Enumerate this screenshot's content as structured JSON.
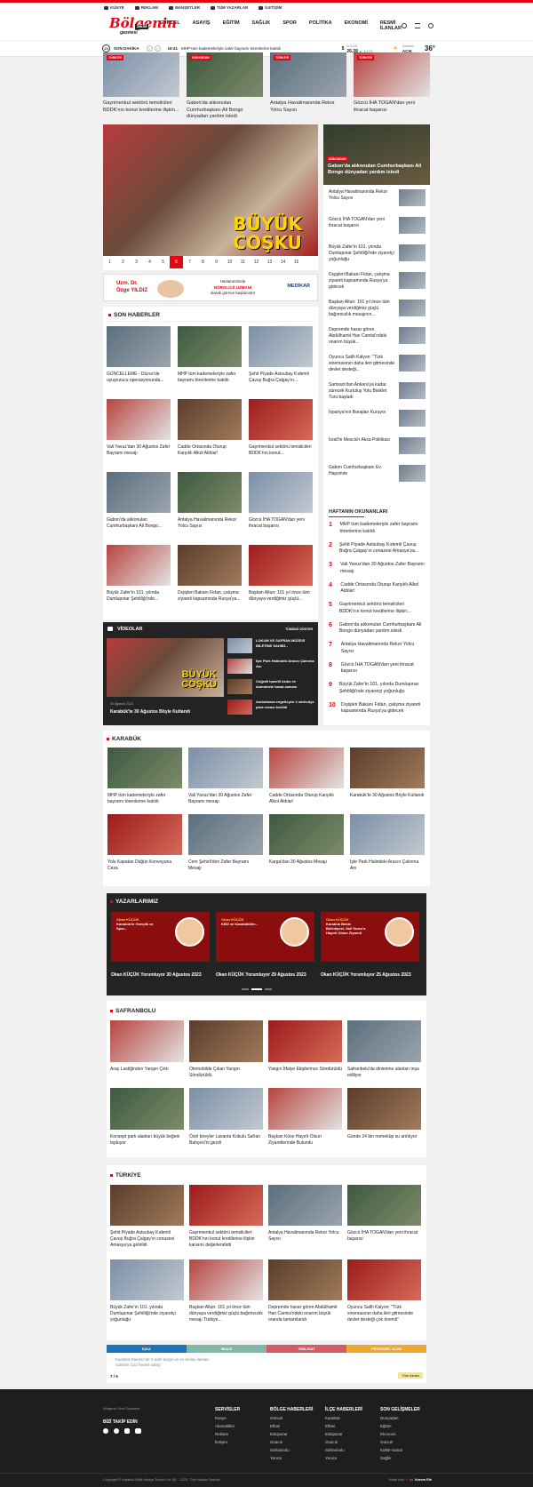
{
  "toplinks": [
    "KÜNYE",
    "REKLAM",
    "MANŞETLER",
    "TÜM YAZARLAR",
    "İLETİŞİM"
  ],
  "logo": {
    "main": "Bölgenin",
    "sub": "gazetesi",
    "badge": "SESİ"
  },
  "nav": [
    "GÜNCEL",
    "ASAYİŞ",
    "EĞİTİM",
    "SAĞLIK",
    "SPOR",
    "POLİTİKA",
    "EKONOMİ",
    "RESMİ İLANLAR"
  ],
  "ticker": {
    "label": "SON DAKİKA",
    "time": "16:41",
    "text": "MHP tüm kademeleriyle zafer bayramı törenlerine katıldı",
    "fx_label": "DOLAR",
    "fx_value": "26,38",
    "fx_change": "▲ -0,17%",
    "wx_city": "Karabük",
    "wx_state": "AÇIK",
    "wx_temp": "36°"
  },
  "top_cards": [
    {
      "tag": "TÜRKİYE",
      "title": "Gayrimenkul sektörü temsilcileri BDDK'nın konut kredilerine ilişkin..."
    },
    {
      "tag": "DÜNYADAN",
      "title": "Gabon'da alıkonulan Cumhurbaşkanı Ali Bongo dünyadan yardım istedi"
    },
    {
      "tag": "TÜRKİYE",
      "title": "Antalya Havalimanında Rekor Yolcu Sayısı"
    },
    {
      "tag": "TÜRKİYE",
      "title": "Gözcü İHA TOGAN'dan yeni ihracat başarısı"
    }
  ],
  "hero": {
    "caption1": "BÜYÜK",
    "caption2": "COŞKU"
  },
  "pages": [
    "1",
    "2",
    "3",
    "4",
    "5",
    "6",
    "7",
    "8",
    "9",
    "10",
    "11",
    "12",
    "13",
    "14",
    "15"
  ],
  "ad": {
    "left1": "Uzm. Dr.",
    "left2": "Özge YILDIZ",
    "mid1": "Hastanemizde",
    "mid2": "NÖROLOJİ UZMANI",
    "mid3": "olarak göreve başlamıştır",
    "right": "MEDİKAR"
  },
  "side_feature": {
    "tag": "DÜNYADAN",
    "title": "Gabon'da alıkonulan Cumhurbaşkanı Ali Bongo dünyadan yardım istedi"
  },
  "side_list": [
    "Antalya Havalimanında Rekor Yolcu Sayısı",
    "Gözcü İHA TOGAN'dan yeni ihracat başarısı",
    "Büyük Zafer'in 101. yılında Dumlupınar Şehitliği'nde ziyaretçi yoğunluğu",
    "Dışişleri Bakanı Fidan, çalışma ziyareti kapsamında Rusya'ya gidecek",
    "Başkan Altun: 101 yıl önce tüm dünyaya verdiğimiz güçlü bağımsızlık mesajının...",
    "Depremde hasar gören Abdülhamit Han Camisi'ndeki onarım büyük...",
    "Oyuncu Salih Kalyon: \"Türk sinemasının daha ileri gitmesinde devlet desteği...",
    "Samsun'dan Ankara'ya kadar sürecek Kurtuluş Yolu Bisiklet Turu başladı",
    "İspanya'nın Barajları Kuruyor",
    "İsrail'in Mescid-i Aksa Politikası",
    "Gabon Cumhurbaşkanı Ev Hapsinde"
  ],
  "son_haberler": {
    "title": "SON HABERLER",
    "items": [
      "GÜNCELLEME - Düzce'de uyuşturucu operasyonunda...",
      "MHP tüm kademeleriyle zafer bayramı törenlerine katıldı",
      "Şehit Piyade Astsubay Kıdemli Çavuş Buğra Çalgay'ın...",
      "Vali Yavuz'dan 30 Ağustos Zafer Bayramı mesajı",
      "Cadde Ortasında Oturup Karşıklı Alkol Aldılar!",
      "Gayrimenkul sektörü temsilcileri BDDK'nın konut...",
      "Gabon'da alıkonulan Cumhurbaşkanı Ali Bongo...",
      "Antalya Havalimanında Rekor Yolcu Sayısı",
      "Gözcü İHA TOGAN'dan yeni ihracat başarısı",
      "Büyük Zafer'in 101. yılında Dumlupınar Şehitliği'nde...",
      "Dışişleri Bakanı Fidan, çalışma ziyareti kapsamında Rusya'ya...",
      "Başkan Altun: 101 yıl önce tüm dünyaya verdiğimiz güçlü..."
    ]
  },
  "haftanin": {
    "title": "HAFTANIN OKUNANLARI",
    "items": [
      "MHP tüm kademeleriyle zafer bayramı törenlerine katıldı",
      "Şehit Piyade Astsubay Kıdemli Çavuş Buğra Çalgay'ın cenazesi Amasya'ya...",
      "Vali Yavuz'dan 30 Ağustos Zafer Bayramı mesajı",
      "Cadde Ortasında Oturup Karşıklı Alkol Aldılar!",
      "Gayrimenkul sektörü temsilcileri BDDK'nın konut kredilerine ilişkin...",
      "Gabon'da alıkonulan Cumhurbaşkanı Ali Bongo dünyadan yardım istedi",
      "Antalya Havalimanında Rekor Yolcu Sayısı",
      "Gözcü İHA TOGAN'dan yeni ihracat başarısı",
      "Büyük Zafer'in 101. yılında Dumlupınar Şehitliği'nde ziyaretçi yoğunluğu",
      "Dışişleri Bakanı Fidan, çalışma ziyareti kapsamında Rusya'ya gidecek"
    ]
  },
  "videolar": {
    "title": "VİDEOLAR",
    "all": "TÜMÜNÜ GÖSTER",
    "main_date": "30 Ağustos 2023",
    "main_title": "Karabük'te 30 Ağustos Böyle Kutlandı",
    "items": [
      "LOKUM VE SAFRAN MÜZESİ BİLETİNE SAHİBİ...",
      "İşte Park Halindeki Aracın Çalınma Anı",
      "Coğrafi işaretli üzüm ve domateste hasat zamanı",
      "Ambulansa engelleyen 2 sürücüye para cezası kesildi"
    ]
  },
  "karabuk": {
    "title": "KARABÜK",
    "items": [
      "MHP tüm kademeleriyle zafer bayramı törenlerine katıldı",
      "Vali Yavuz'dan 30 Ağustos Zafer Bayramı mesajı",
      "Cadde Ortasında Oturup Karşıklı Alkol Aldılar!",
      "Karabük'te 30 Ağustos Böyle Kutlandı",
      "Yolu Kapatan Düğün Konvoyuna Ceza",
      "Cem Şehirli'den Zafer Bayramı Mesajı",
      "Karga'dan 30 Ağustos Mesajı",
      "İşte Park Halindeki Aracın Çalınma Anı"
    ]
  },
  "yazarlar": {
    "title": "YAZARLARIMIZ",
    "items": [
      {
        "name": "Okan KÜÇÜK",
        "head": "Karabük'te Gençlik ve Spor...",
        "cap": "Okan KÜÇÜK Yorumluyor 30 Ağustos 2023"
      },
      {
        "name": "Okan KÜÇÜK",
        "head": "KBÜ ve Karabükliler...",
        "cap": "Okan KÜÇÜK Yorumluyor 29 Ağustos 2023"
      },
      {
        "name": "Okan KÜÇÜK",
        "head": "Karabük Belde Belediyesi, Vali Yavuz'a Hayırlı Olsun Ziyareti",
        "cap": "Okan KÜÇÜK Yorumluyor 25 Ağustos 2023"
      }
    ]
  },
  "safranbolu": {
    "title": "SAFRANBOLU",
    "items": [
      "Araç Lastiğinden Yangın Çıktı",
      "Otomobilde Çıkan Yangın Söndürüldü",
      "Yangın İtfaiye Ekiplerince Söndürüldü",
      "Safranbolu'da dinlenme alanları inşa ediliyor",
      "Konsept park alanları büyük beğeni topluyor",
      "Özel bireyler Lavanta Kokulu Safran Bahçesi'ni gezdi",
      "Başkan Köse Hayırlı Olsun Ziyaretlerinde Bulundu",
      "Günde 24 bin metreküp su arıtılıyor"
    ]
  },
  "turkiye": {
    "title": "TÜRKİYE",
    "items": [
      "Şehit Piyade Astsubay Kıdemli Çavuş Buğra Çalgay'ın cenazesi Amasya'ya getirildi",
      "Gayrimenkul sektörü temsilcileri BDDK'nın konut kredilerine ilişkin kararını değerlendirdi",
      "Antalya Havalimanında Rekor Yolcu Sayısı",
      "Gözcü İHA TOGAN'dan yeni ihracat başarısı",
      "Büyük Zafer'in 101. yılında Dumlupınar Şehitliği'nde ziyaretçi yoğunluğu",
      "Başkan Altun: 101 yıl önce tüm dünyaya verdiğimiz güçlü bağımsızlık mesajı Türkiye...",
      "Depremde hasar gören Abdülhamit Han Camisi'ndeki onarım büyük oranda tamamlandı",
      "Oyuncu Salih Kalyon: \"Türk sinemasının daha ileri gitmesinde devlet desteği çok önemli\""
    ]
  },
  "tabs": [
    "İÇKA",
    "İMALE",
    "TEBLİGAT",
    "PERSONEL ALIMI"
  ],
  "tabs_text": "Karabük Merkez'de 3 adet bargir ve ev arsası ilanları satılıktır (1/2 hisseli satış)",
  "tabs_counter": "7 / 9",
  "tabs_all": "Tüm ilanlar",
  "footer": {
    "site": "Bölgenin Sesi Gazetesi",
    "follow": "BİZİ TAKİP EDİN",
    "cols": [
      {
        "h": "SERVİSLER",
        "items": [
          "Künye",
          "Abonelikler",
          "Reklam",
          "İletişim"
        ]
      },
      {
        "h": "BÖLGE HABERLERİ",
        "items": [
          "Güncel",
          "Eflani",
          "Eskipazar",
          "Ovacık",
          "Safranbolu",
          "Yenice"
        ]
      },
      {
        "h": "İLÇE HABERLERİ",
        "items": [
          "Karabük",
          "Eflani",
          "Eskipazar",
          "Ovacık",
          "Safranbolu",
          "Yenice"
        ]
      },
      {
        "h": "SON GELİŞMELER",
        "items": [
          "Dünyadan",
          "Eğitim",
          "Ekonomi",
          "Güncel",
          "Kültür-Sanat",
          "Sağlık"
        ]
      }
    ],
    "copyright": "Copyright © Karabük Birlik Medya Ticaret Ltd. Şti. - 2023. Tüm Hakları Saklıdır.",
    "made": "Made with",
    "by": "by",
    "author": "Kerem Efe"
  },
  "colors": {
    "brand": "#e30613",
    "dark": "#232323",
    "tab1": "#1c75bc",
    "tab2": "#7fb8a8",
    "tab3": "#d65a63",
    "tab4": "#f0a930"
  }
}
